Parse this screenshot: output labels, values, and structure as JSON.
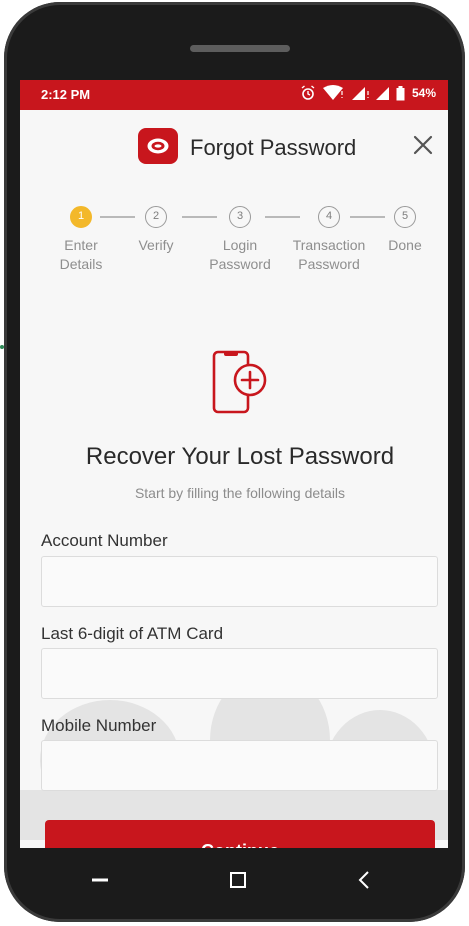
{
  "status_bar": {
    "time": "2:12 PM",
    "battery": "54%",
    "icons": [
      "alarm-icon",
      "wifi-icon",
      "signal-icon",
      "signal-icon",
      "battery-icon"
    ]
  },
  "header": {
    "title": "Forgot Password",
    "logo_icon": "bank-logo-icon",
    "close_icon": "close-icon"
  },
  "stepper": {
    "steps": [
      {
        "number": "1",
        "label_line1": "Enter",
        "label_line2": "Details",
        "active": true
      },
      {
        "number": "2",
        "label_line1": "Verify",
        "label_line2": "",
        "active": false
      },
      {
        "number": "3",
        "label_line1": "Login",
        "label_line2": "Password",
        "active": false
      },
      {
        "number": "4",
        "label_line1": "Transaction",
        "label_line2": "Password",
        "active": false
      },
      {
        "number": "5",
        "label_line1": "Done",
        "label_line2": "",
        "active": false
      }
    ]
  },
  "main": {
    "illustration_icon": "phone-add-icon",
    "heading": "Recover Your Lost Password",
    "subheading": "Start by filling the following details"
  },
  "form": {
    "fields": [
      {
        "label": "Account Number",
        "value": ""
      },
      {
        "label": "Last 6-digit of ATM Card",
        "value": ""
      },
      {
        "label": "Mobile Number",
        "value": ""
      }
    ],
    "continue_label": "Continue"
  },
  "colors": {
    "brand_red": "#c8161d",
    "active_step": "#f3b82a"
  },
  "navbar": {
    "icons": [
      "recents-icon",
      "home-icon",
      "back-icon"
    ]
  }
}
